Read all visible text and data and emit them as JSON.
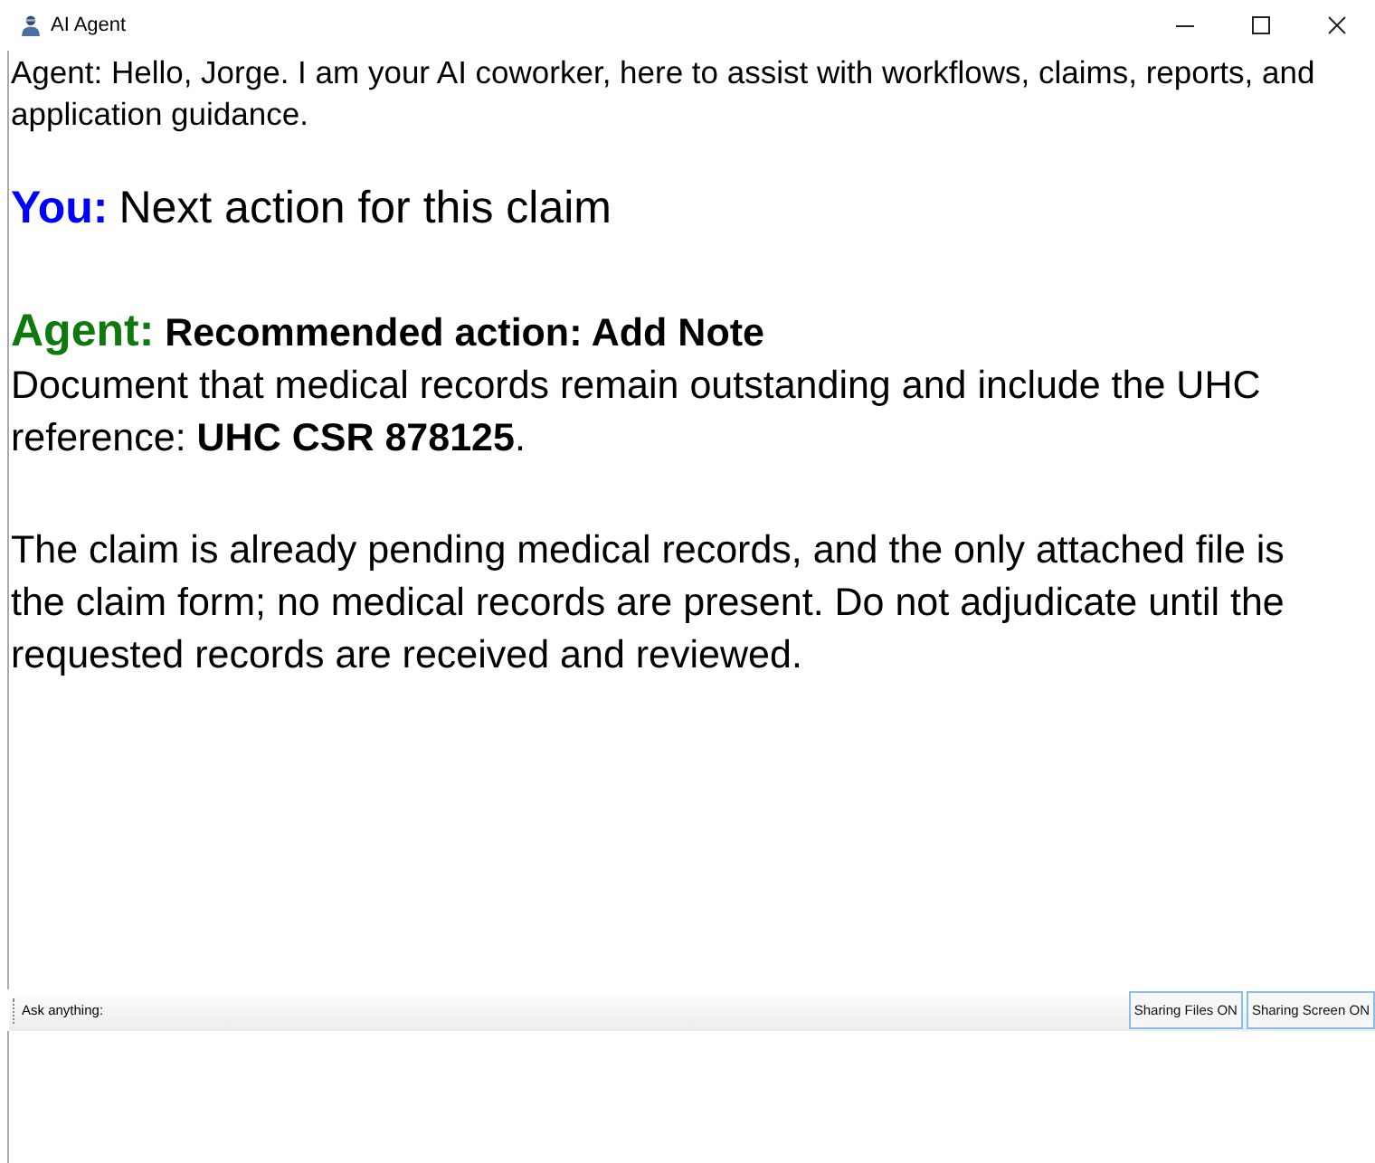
{
  "window": {
    "title": "AI Agent"
  },
  "messages": [
    {
      "kind": "greeting",
      "text": "Agent: Hello, Jorge. I am your AI coworker, here to assist with workflows, claims, reports, and application guidance."
    },
    {
      "kind": "user",
      "speaker": "You:",
      "color": "#0000ff",
      "text": "Next action for this claim"
    },
    {
      "kind": "agent",
      "speaker": "Agent:",
      "color": "#0e7a0e",
      "heading": "Recommended action: Add Note",
      "paragraphs": [
        "Document that medical records remain outstanding and include the UHC reference: **UHC CSR 878125**.",
        "The claim is already pending medical records, and the only attached file is the claim form; no medical records are present. Do not adjudicate until the requested records are received and reviewed."
      ]
    }
  ],
  "input_bar": {
    "label": "Ask anything:",
    "buttons": [
      {
        "label": "Sharing Files ON"
      },
      {
        "label": "Sharing Screen ON"
      }
    ]
  }
}
